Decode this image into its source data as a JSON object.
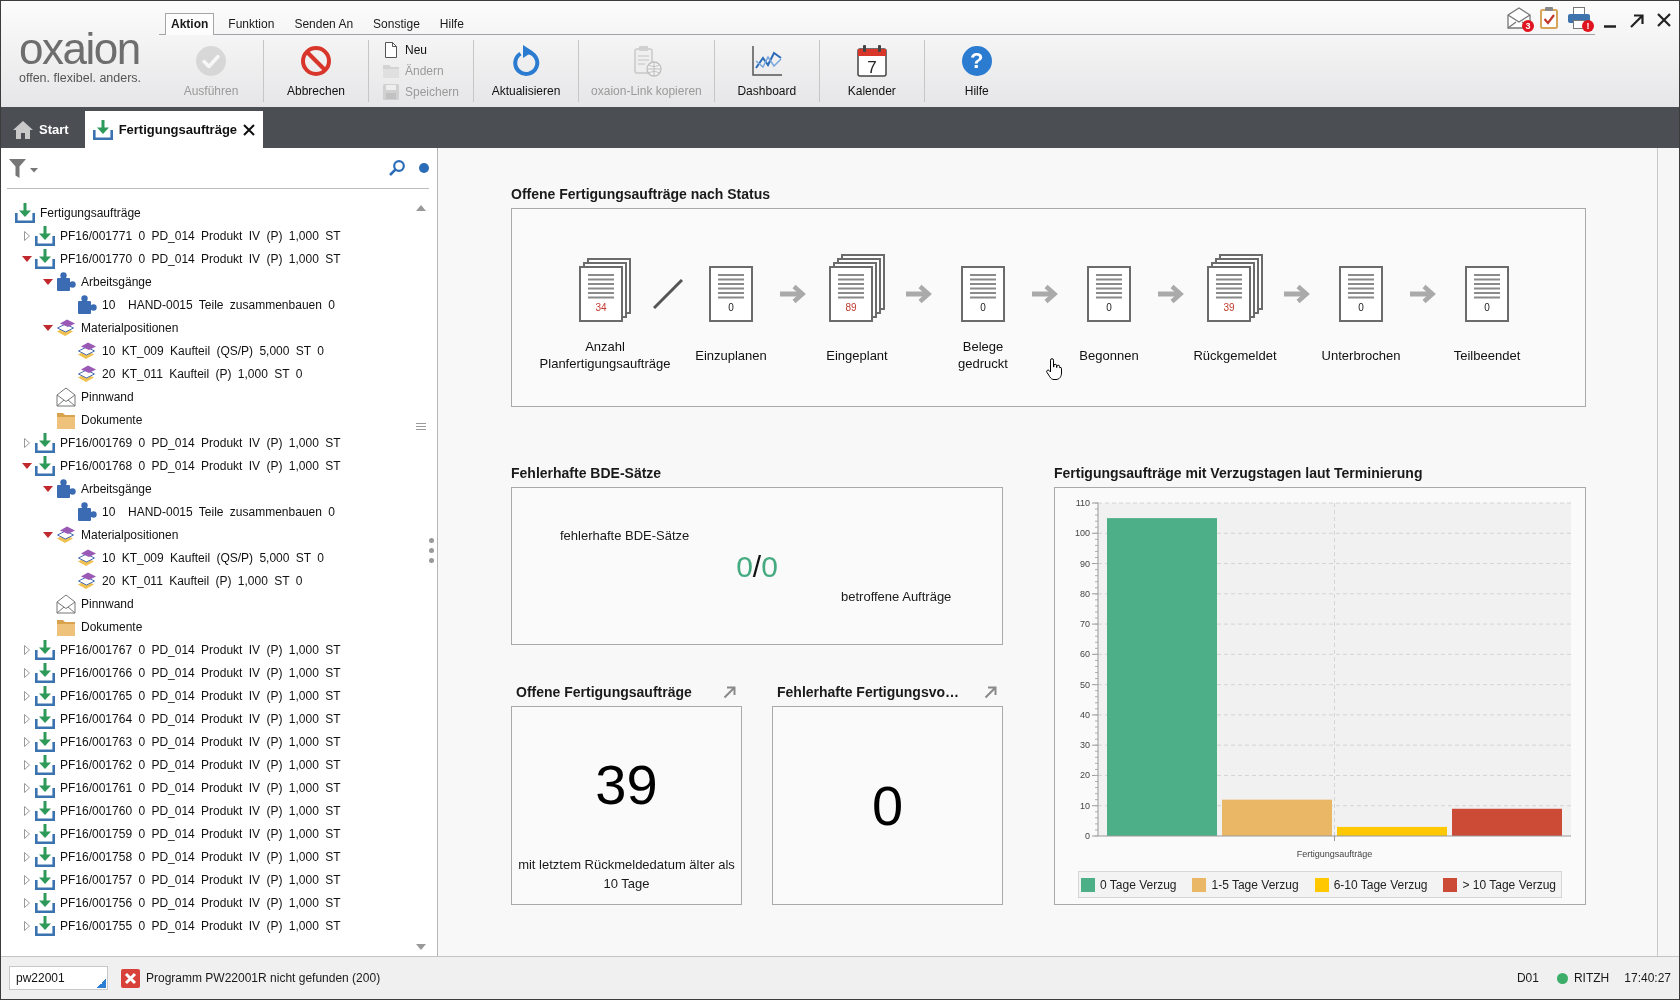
{
  "logo": {
    "name": "oxaion",
    "tagline": "offen. flexibel. anders."
  },
  "menu_tabs": [
    {
      "label": "Aktion",
      "selected": true
    },
    {
      "label": "Funktion",
      "selected": false
    },
    {
      "label": "Senden An",
      "selected": false
    },
    {
      "label": "Sonstige",
      "selected": false
    },
    {
      "label": "Hilfe",
      "selected": false
    }
  ],
  "tray": [
    {
      "kind": "mail",
      "badge": "3"
    },
    {
      "kind": "tasks"
    },
    {
      "kind": "printer",
      "badge": "!"
    }
  ],
  "toolbar": [
    {
      "buttons": [
        {
          "kind": "run",
          "label": "Ausführen",
          "disabled": true
        }
      ]
    },
    {
      "buttons": [
        {
          "kind": "cancel",
          "label": "Abbrechen",
          "disabled": false
        }
      ]
    },
    {
      "buttons": [
        {
          "kind": "new",
          "label": "Neu",
          "disabled": false
        },
        {
          "kind": "edit",
          "label": "Ändern",
          "disabled": true
        },
        {
          "kind": "save",
          "label": "Speichern",
          "disabled": true
        }
      ]
    },
    {
      "buttons": [
        {
          "kind": "refresh",
          "label": "Aktualisieren",
          "disabled": false
        }
      ]
    },
    {
      "buttons": [
        {
          "kind": "copy-link",
          "label": "oxaion-Link kopieren",
          "disabled": true
        }
      ]
    },
    {
      "buttons": [
        {
          "kind": "dashboard",
          "label": "Dashboard",
          "disabled": false
        }
      ]
    },
    {
      "buttons": [
        {
          "kind": "calendar",
          "label": "Kalender",
          "disabled": false,
          "icon_text": "7"
        }
      ]
    },
    {
      "buttons": [
        {
          "kind": "help",
          "label": "Hilfe",
          "disabled": false,
          "icon_text": "?"
        }
      ]
    }
  ],
  "doc_tabs": [
    {
      "kind": "home",
      "label": "Start",
      "selected": false,
      "closable": false
    },
    {
      "kind": "orders",
      "label": "Fertigungsaufträge",
      "selected": true,
      "closable": true
    }
  ],
  "tree": {
    "label": "Fertigungsaufträge",
    "kind": "order",
    "children": [
      {
        "label": "PF16/001771 0 PD_014 Produkt IV (P) 1,000 ST",
        "kind": "order",
        "expanded": false
      },
      {
        "label": "PF16/001770 0 PD_014 Produkt IV (P) 1,000 ST",
        "kind": "order",
        "expanded": true,
        "children": [
          {
            "label": "Arbeitsgänge",
            "kind": "operations",
            "expanded": true,
            "children": [
              {
                "label": "10  HAND-0015 Teile zusammenbauen 0",
                "kind": "operation"
              }
            ]
          },
          {
            "label": "Materialpositionen",
            "kind": "materials",
            "expanded": true,
            "children": [
              {
                "label": "10 KT_009 Kaufteil (QS/P) 5,000 ST 0",
                "kind": "material"
              },
              {
                "label": "20 KT_011 Kaufteil (P) 1,000 ST 0",
                "kind": "material"
              }
            ]
          },
          {
            "label": "Pinnwand",
            "kind": "pinboard"
          },
          {
            "label": "Dokumente",
            "kind": "documents"
          }
        ]
      },
      {
        "label": "PF16/001769 0 PD_014 Produkt IV (P) 1,000 ST",
        "kind": "order",
        "expanded": false
      },
      {
        "label": "PF16/001768 0 PD_014 Produkt IV (P) 1,000 ST",
        "kind": "order",
        "expanded": true,
        "children": [
          {
            "label": "Arbeitsgänge",
            "kind": "operations",
            "expanded": true,
            "children": [
              {
                "label": "10  HAND-0015 Teile zusammenbauen 0",
                "kind": "operation"
              }
            ]
          },
          {
            "label": "Materialpositionen",
            "kind": "materials",
            "expanded": true,
            "children": [
              {
                "label": "10 KT_009 Kaufteil (QS/P) 5,000 ST 0",
                "kind": "material"
              },
              {
                "label": "20 KT_011 Kaufteil (P) 1,000 ST 0",
                "kind": "material"
              }
            ]
          },
          {
            "label": "Pinnwand",
            "kind": "pinboard"
          },
          {
            "label": "Dokumente",
            "kind": "documents"
          }
        ]
      },
      {
        "label": "PF16/001767 0 PD_014 Produkt IV (P) 1,000 ST",
        "kind": "order",
        "expanded": false
      },
      {
        "label": "PF16/001766 0 PD_014 Produkt IV (P) 1,000 ST",
        "kind": "order",
        "expanded": false
      },
      {
        "label": "PF16/001765 0 PD_014 Produkt IV (P) 1,000 ST",
        "kind": "order",
        "expanded": false
      },
      {
        "label": "PF16/001764 0 PD_014 Produkt IV (P) 1,000 ST",
        "kind": "order",
        "expanded": false
      },
      {
        "label": "PF16/001763 0 PD_014 Produkt IV (P) 1,000 ST",
        "kind": "order",
        "expanded": false
      },
      {
        "label": "PF16/001762 0 PD_014 Produkt IV (P) 1,000 ST",
        "kind": "order",
        "expanded": false
      },
      {
        "label": "PF16/001761 0 PD_014 Produkt IV (P) 1,000 ST",
        "kind": "order",
        "expanded": false
      },
      {
        "label": "PF16/001760 0 PD_014 Produkt IV (P) 1,000 ST",
        "kind": "order",
        "expanded": false
      },
      {
        "label": "PF16/001759 0 PD_014 Produkt IV (P) 1,000 ST",
        "kind": "order",
        "expanded": false
      },
      {
        "label": "PF16/001758 0 PD_014 Produkt IV (P) 1,000 ST",
        "kind": "order",
        "expanded": false
      },
      {
        "label": "PF16/001757 0 PD_014 Produkt IV (P) 1,000 ST",
        "kind": "order",
        "expanded": false
      },
      {
        "label": "PF16/001756 0 PD_014 Produkt IV (P) 1,000 ST",
        "kind": "order",
        "expanded": false
      },
      {
        "label": "PF16/001755 0 PD_014 Produkt IV (P) 1,000 ST",
        "kind": "order",
        "expanded": false
      }
    ]
  },
  "status_flow": {
    "title": "Offene Fertigungsaufträge nach Status",
    "items": [
      {
        "kind": "stack",
        "count": "34",
        "label": "Anzahl Planfertigungsaufträge"
      },
      {
        "kind": "slash"
      },
      {
        "kind": "single",
        "count": "0",
        "label": "Einzuplanen"
      },
      {
        "kind": "arrow"
      },
      {
        "kind": "large-stack",
        "count": "89",
        "label": "Eingeplant"
      },
      {
        "kind": "arrow"
      },
      {
        "kind": "single",
        "count": "0",
        "label": "Belege gedruckt"
      },
      {
        "kind": "arrow"
      },
      {
        "kind": "single",
        "count": "0",
        "label": "Begonnen"
      },
      {
        "kind": "arrow"
      },
      {
        "kind": "large-stack",
        "count": "39",
        "label": "Rückgemeldet"
      },
      {
        "kind": "arrow"
      },
      {
        "kind": "single",
        "count": "0",
        "label": "Unterbrochen"
      },
      {
        "kind": "arrow"
      },
      {
        "kind": "single",
        "count": "0",
        "label": "Teilbeendet"
      }
    ]
  },
  "bde": {
    "title": "Fehlerhafte BDE-Sätze",
    "records_label": "fehlerhafte BDE-Sätze",
    "records": "0",
    "separator": "/",
    "orders": "0",
    "orders_label": "betroffene Aufträge"
  },
  "tiles": [
    {
      "title": "Offene Fertigungsaufträge",
      "value": "39",
      "caption": "mit letztem Rückmeldedatum älter als 10 Tage"
    },
    {
      "title": "Fehlerhafte Fertigungsvo…",
      "value": "0"
    }
  ],
  "delay_chart": {
    "chart_data": {
      "type": "bar",
      "title": "Fertigungsaufträge mit Verzugstagen laut Terminierung",
      "categories": [
        "Fertigungsaufträge"
      ],
      "series": [
        {
          "name": "0 Tage Verzug",
          "color": "#4caf87",
          "values": [
            105
          ]
        },
        {
          "name": "1-5 Tage Verzug",
          "color": "#e9b766",
          "values": [
            12
          ]
        },
        {
          "name": "6-10 Tage Verzug",
          "color": "#ffc800",
          "values": [
            3
          ]
        },
        {
          "name": "> 10 Tage Verzug",
          "color": "#cc4b36",
          "values": [
            9
          ]
        }
      ],
      "ylim": [
        0,
        110
      ],
      "yticks": [
        0,
        10,
        20,
        30,
        40,
        50,
        60,
        70,
        80,
        90,
        100,
        110
      ],
      "grid": true,
      "legend": true
    }
  },
  "status_bar": {
    "command": "pw22001",
    "message": "Programm PW22001R nicht gefunden (200)",
    "system": "D01",
    "connected": true,
    "user": "RITZH",
    "time": "17:40:27"
  }
}
